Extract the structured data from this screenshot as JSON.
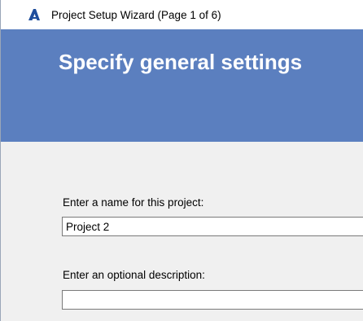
{
  "window": {
    "title": "Project Setup Wizard (Page 1 of 6)",
    "icon": "autodesk-a-icon"
  },
  "banner": {
    "heading": "Specify general settings"
  },
  "form": {
    "name_label": "Enter a name for this project:",
    "name_value": "Project 2",
    "description_label": "Enter an optional description:",
    "description_value": ""
  },
  "colors": {
    "banner": "#5b7fbf",
    "content_bg": "#f0f0f0",
    "icon_blue": "#1f4e9c"
  }
}
